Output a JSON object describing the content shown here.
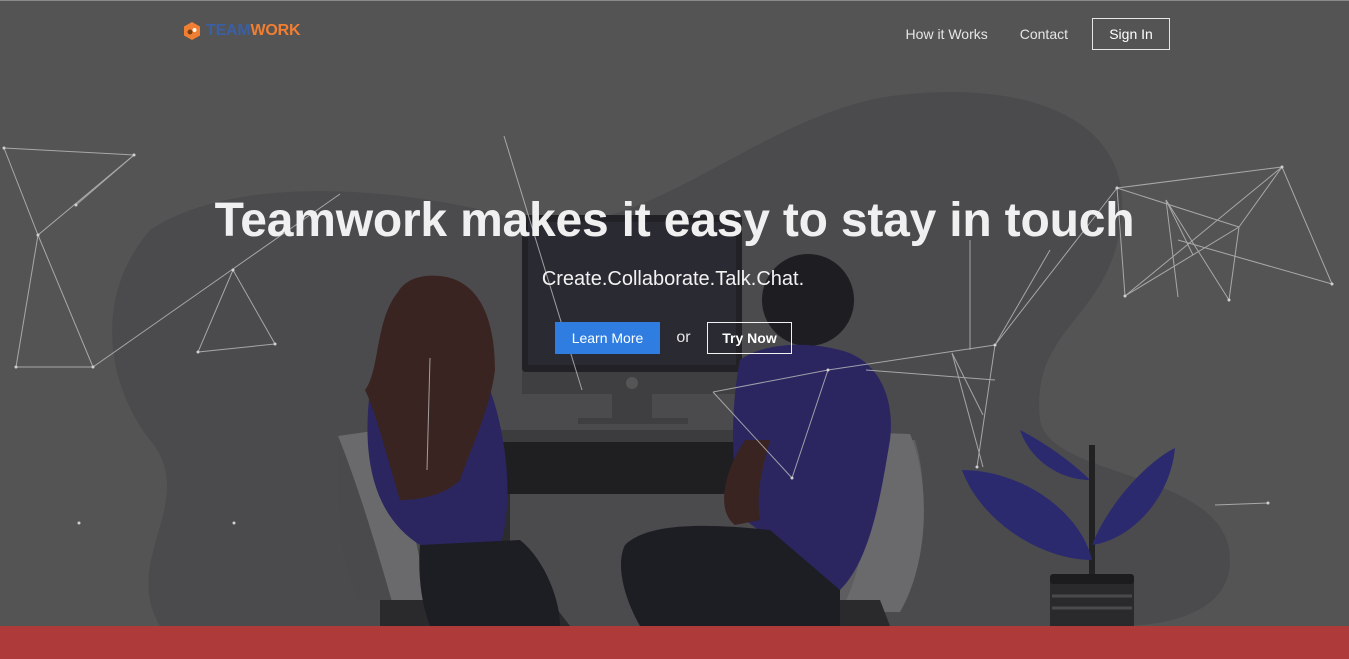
{
  "header": {
    "logo": {
      "part_a": "TEAM",
      "part_b": "WORK",
      "icon": "hexagon-logo-icon"
    },
    "nav": [
      {
        "label": "How it Works"
      },
      {
        "label": "Contact"
      }
    ],
    "signin_label": "Sign In"
  },
  "hero": {
    "title": "Teamwork makes it easy to stay in touch",
    "subtitle": "Create.Collaborate.Talk.Chat.",
    "primary_label": "Learn More",
    "or_text": "or",
    "secondary_label": "Try Now",
    "illustration": "two-people-at-computer-illustration"
  },
  "colors": {
    "background": "#545454",
    "primary_button": "#2f7de1",
    "brand_blue": "#3b5fa3",
    "brand_orange": "#f07f33",
    "bottom_band": "#ae3a3a"
  }
}
